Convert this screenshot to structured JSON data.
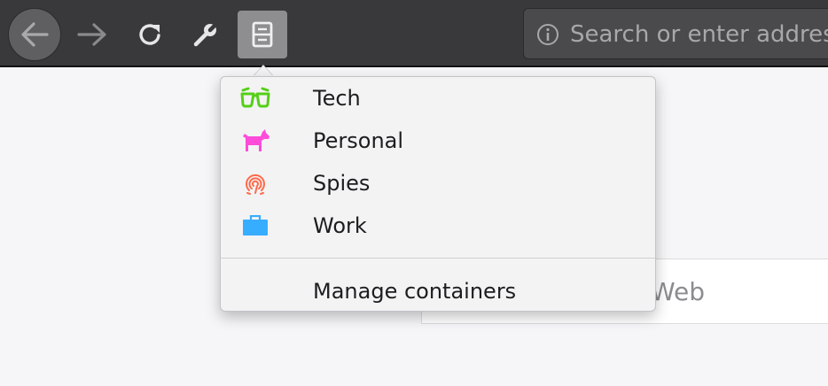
{
  "toolbar": {
    "url_placeholder": "Search or enter address"
  },
  "page": {
    "search_text": "Web"
  },
  "containers_menu": {
    "items": [
      {
        "label": "Tech",
        "icon": "glasses-icon",
        "color": "#55cf17"
      },
      {
        "label": "Personal",
        "icon": "dog-icon",
        "color": "#ff4bda"
      },
      {
        "label": "Spies",
        "icon": "fingerprint-icon",
        "color": "#ff6a4a"
      },
      {
        "label": "Work",
        "icon": "briefcase-icon",
        "color": "#37adff"
      }
    ],
    "manage_label": "Manage containers"
  }
}
